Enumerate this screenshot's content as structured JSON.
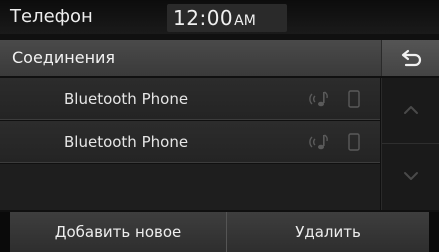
{
  "status_bar": {
    "app_title": "Телефон",
    "time": "12:00",
    "ampm": "AM"
  },
  "header": {
    "title": "Соединения",
    "back_icon": "back-arrow-icon"
  },
  "devices": [
    {
      "name": "Bluetooth Phone",
      "audio_icon": "bluetooth-audio-icon",
      "phone_icon": "phone-icon"
    },
    {
      "name": "Bluetooth Phone",
      "audio_icon": "bluetooth-audio-icon",
      "phone_icon": "phone-icon"
    }
  ],
  "scroll": {
    "up_icon": "chevron-up-icon",
    "down_icon": "chevron-down-icon"
  },
  "bottom": {
    "add_label": "Добавить новое",
    "delete_label": "Удалить"
  },
  "colors": {
    "background": "#101010",
    "header": "#3f3f3f",
    "list_item": "#282828",
    "text": "#e8e8e8",
    "dim_icon": "#5a5a5a"
  }
}
